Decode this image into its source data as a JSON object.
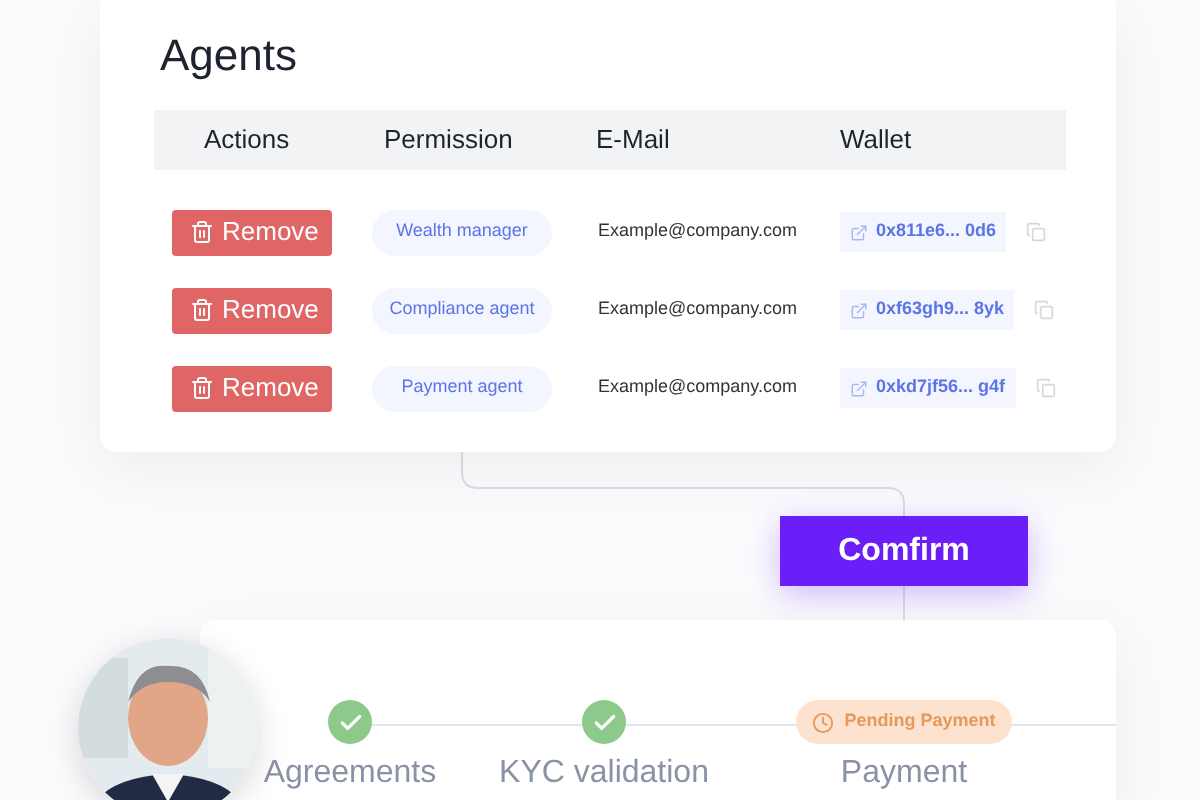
{
  "title": "Agents",
  "table": {
    "columns": [
      "Actions",
      "Permission",
      "E-Mail",
      "Wallet"
    ],
    "rows": [
      {
        "action": "Remove",
        "permission": "Wealth manager",
        "email": "Example@company.com",
        "wallet": "0x811e6... 0d6"
      },
      {
        "action": "Remove",
        "permission": "Compliance agent",
        "email": "Example@company.com",
        "wallet": "0xf63gh9... 8yk"
      },
      {
        "action": "Remove",
        "permission": "Payment agent",
        "email": "Example@company.com",
        "wallet": "0xkd7jf56... g4f"
      }
    ]
  },
  "confirm": "Comfirm",
  "steps": [
    {
      "label": "Agreements",
      "kind": "done"
    },
    {
      "label": "KYC validation",
      "kind": "done"
    },
    {
      "label": "Payment",
      "kind": "pending",
      "badge": "Pending Payment"
    }
  ]
}
